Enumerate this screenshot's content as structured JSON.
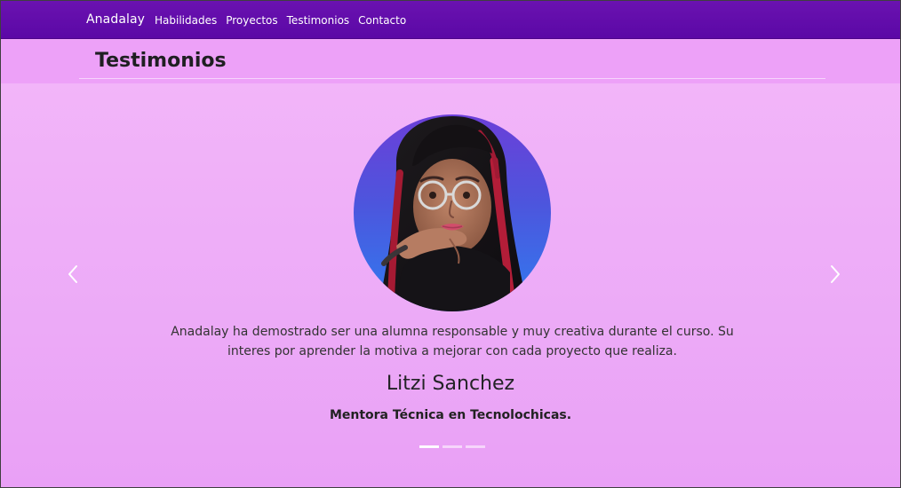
{
  "navbar": {
    "brand": "Anadalay",
    "links": [
      "Habilidades",
      "Proyectos",
      "Testimonios",
      "Contacto"
    ]
  },
  "section": {
    "title": "Testimonios"
  },
  "carousel": {
    "quote": "Anadalay ha demostrado ser una alumna responsable y muy creativa durante el curso. Su interes por aprender la motiva a mejorar con cada proyecto que realiza.",
    "name": "Litzi Sanchez",
    "role": "Mentora Técnica en Tecnolochicas.",
    "slide_count": 3,
    "active_slide": 1
  },
  "icons": {
    "prev": "chevron-left-icon",
    "next": "chevron-right-icon"
  }
}
